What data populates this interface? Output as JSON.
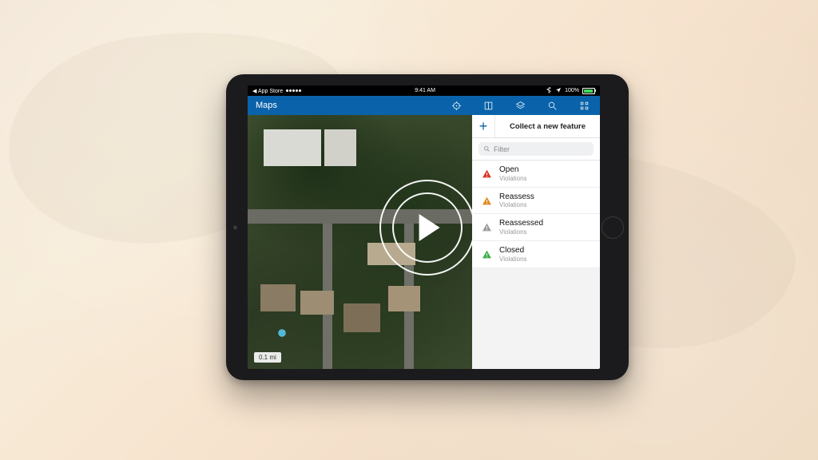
{
  "status": {
    "back_to": "App Store",
    "time": "9:41 AM",
    "battery_pct": "100%"
  },
  "nav": {
    "title": "Maps"
  },
  "map": {
    "scale_label": "0.1 mi"
  },
  "panel": {
    "title": "Collect a new feature",
    "filter_placeholder": "Filter",
    "items": [
      {
        "label": "Open",
        "sub": "Violations",
        "color": "#d93a2b"
      },
      {
        "label": "Reassess",
        "sub": "Violations",
        "color": "#e08a1e"
      },
      {
        "label": "Reassessed",
        "sub": "Violations",
        "color": "#9c9c9c"
      },
      {
        "label": "Closed",
        "sub": "Violations",
        "color": "#3fae49"
      }
    ]
  },
  "overlay": {
    "play_label": "Play video"
  }
}
